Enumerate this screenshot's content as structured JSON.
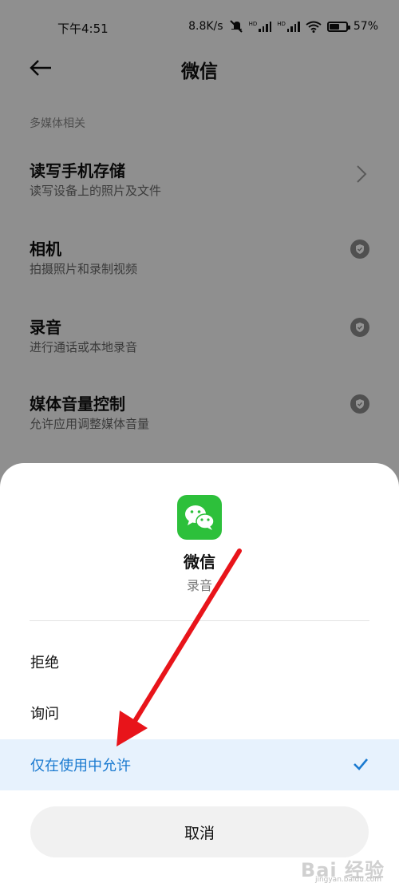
{
  "status_bar": {
    "time": "下午4:51",
    "net_speed": "8.8K/s",
    "hd1": "HD",
    "hd2": "HD",
    "battery": "57%",
    "battery_level": 0.57
  },
  "header": {
    "title": "微信"
  },
  "section": {
    "heading": "多媒体相关"
  },
  "permissions": [
    {
      "title": "读写手机存储",
      "desc": "读写设备上的照片及文件"
    },
    {
      "title": "相机",
      "desc": "拍摄照片和录制视频"
    },
    {
      "title": "录音",
      "desc": "进行通话或本地录音"
    },
    {
      "title": "媒体音量控制",
      "desc": "允许应用调整媒体音量"
    }
  ],
  "dialog": {
    "app_name": "微信",
    "permission": "录音",
    "options": [
      "拒绝",
      "询问",
      "仅在使用中允许"
    ],
    "selected_index": 2,
    "cancel": "取消"
  },
  "watermark": {
    "text": "Bai 经验",
    "url": "jingyan.baidu.com"
  },
  "icons": {
    "back": "arrow-left-icon",
    "chevron": "chevron-right-icon",
    "shield": "shield-check-icon",
    "check": "checkmark-icon",
    "app": "wechat-icon"
  },
  "colors": {
    "accent": "#1a7ad0",
    "selected_bg": "#e7f2fd",
    "wechat_green": "#2dc03b",
    "annotation_arrow": "#e8141a"
  }
}
